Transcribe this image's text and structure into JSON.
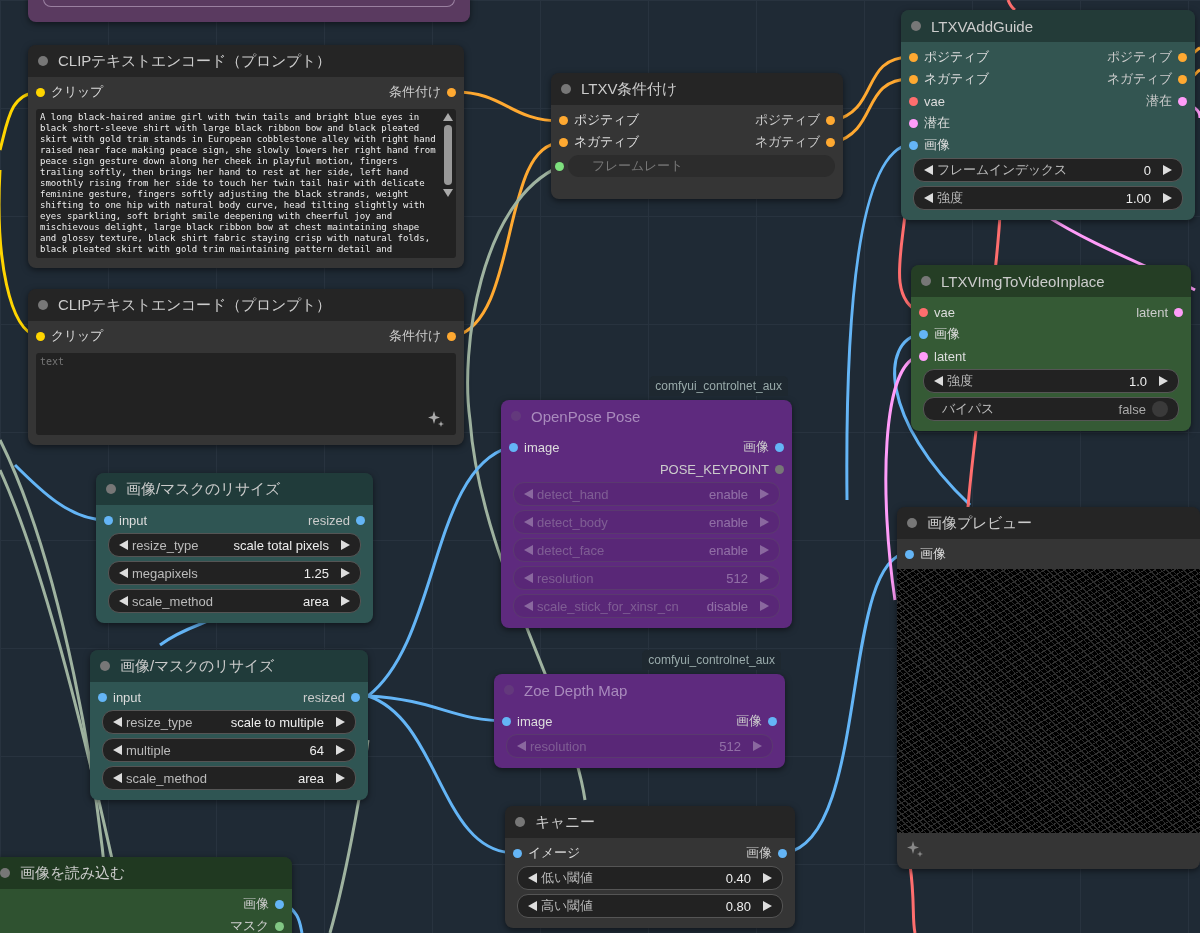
{
  "nodes": [
    {
      "title": "CLIPテキストエンコード（プロンプト）",
      "color": "#353535",
      "bypassed": false,
      "inputs": [
        {
          "label": "クリップ",
          "color": "#ffd500"
        }
      ],
      "outputs": [
        {
          "label": "条件付け",
          "color": "#ffa931"
        }
      ],
      "prompt": {
        "value": "A long black-haired anime girl with twin tails and bright blue eyes in black short-sleeve shirt with large black ribbon bow and black pleated skirt with gold trim stands in European cobblestone alley with right hand raised near face making peace sign, she slowly lowers her right hand from peace sign gesture down along her cheek in playful motion, fingers trailing softly, then brings her hand to rest at her side, left hand smoothly rising from her side to touch her twin tail hair with delicate feminine gesture, fingers softly adjusting the black strands, weight shifting to one hip with natural body curve, head tilting slightly with eyes sparkling, soft bright smile deepening with cheerful joy and mischievous delight, large black ribbon bow at chest maintaining shape and glossy texture, black shirt fabric staying crisp with natural folds, black pleated skirt with gold trim maintaining pattern detail and"
      }
    },
    {
      "title": "CLIPテキストエンコード（プロンプト）",
      "color": "#353535",
      "bypassed": false,
      "inputs": [
        {
          "label": "クリップ",
          "color": "#ffd500"
        }
      ],
      "outputs": [
        {
          "label": "条件付け",
          "color": "#ffa931"
        }
      ],
      "prompt": {
        "placeholder": "text"
      }
    },
    {
      "title": "LTXV条件付け",
      "color": "#353535",
      "bypassed": false,
      "inputs": [
        {
          "label": "ポジティブ",
          "color": "#ffa931"
        },
        {
          "label": "ネガティブ",
          "color": "#ffa931"
        }
      ],
      "outputs": [
        {
          "label": "ポジティブ",
          "color": "#ffa931"
        },
        {
          "label": "ネガティブ",
          "color": "#ffa931"
        }
      ],
      "widgets": [
        {
          "kind": "socket",
          "label": "フレームレート",
          "color": "#7ee07e"
        }
      ]
    },
    {
      "title": "LTXVAddGuide",
      "color": "#335551",
      "bypassed": false,
      "inputs": [
        {
          "label": "ポジティブ",
          "color": "#ffa931"
        },
        {
          "label": "ネガティブ",
          "color": "#ffa931"
        },
        {
          "label": "vae",
          "color": "#ff6e6e"
        },
        {
          "label": "潜在",
          "color": "#ff9cf9"
        },
        {
          "label": "画像",
          "color": "#64b5f6"
        }
      ],
      "outputs": [
        {
          "label": "ポジティブ",
          "color": "#ffa931"
        },
        {
          "label": "ネガティブ",
          "color": "#ffa931"
        },
        {
          "label": "潜在",
          "color": "#ff9cf9"
        }
      ],
      "widgets": [
        {
          "kind": "number",
          "label": "フレームインデックス",
          "value": "0"
        },
        {
          "kind": "number",
          "label": "強度",
          "value": "1.00"
        }
      ]
    },
    {
      "title": "LTXVImgToVideoInplace",
      "color": "#355a35",
      "bypassed": false,
      "inputs": [
        {
          "label": "vae",
          "color": "#ff6e6e"
        },
        {
          "label": "画像",
          "color": "#64b5f6"
        },
        {
          "label": "latent",
          "color": "#ff9cf9"
        }
      ],
      "outputs": [
        {
          "label": "latent",
          "color": "#ff9cf9"
        }
      ],
      "widgets": [
        {
          "kind": "number",
          "label": "強度",
          "value": "1.0"
        },
        {
          "kind": "toggle",
          "label": "バイパス",
          "value": "false",
          "on": false
        }
      ]
    },
    {
      "title": "画像/マスクのリサイズ",
      "color": "#2f5553",
      "bypassed": false,
      "inputs": [
        {
          "label": "input",
          "color": "#64b5f6"
        }
      ],
      "outputs": [
        {
          "label": "resized",
          "color": "#64b5f6"
        }
      ],
      "widgets": [
        {
          "kind": "combo",
          "label": "resize_type",
          "value": "scale total pixels"
        },
        {
          "kind": "number",
          "label": "megapixels",
          "value": "1.25"
        },
        {
          "kind": "combo",
          "label": "scale_method",
          "value": "area"
        }
      ]
    },
    {
      "title": "OpenPose Pose",
      "color": "#5e2a7e",
      "bypassed": true,
      "badge": "comfyui_controlnet_aux",
      "inputs": [
        {
          "label": "image",
          "color": "#64b5f6"
        }
      ],
      "outputs": [
        {
          "label": "画像",
          "color": "#64b5f6"
        },
        {
          "label": "POSE_KEYPOINT",
          "color": "#777777"
        }
      ],
      "widgets": [
        {
          "kind": "combo",
          "label": "detect_hand",
          "value": "enable"
        },
        {
          "kind": "combo",
          "label": "detect_body",
          "value": "enable"
        },
        {
          "kind": "combo",
          "label": "detect_face",
          "value": "enable"
        },
        {
          "kind": "number",
          "label": "resolution",
          "value": "512"
        },
        {
          "kind": "combo",
          "label": "scale_stick_for_xinsr_cn",
          "value": "disable"
        }
      ]
    },
    {
      "title": "画像/マスクのリサイズ",
      "color": "#2f5553",
      "bypassed": false,
      "inputs": [
        {
          "label": "input",
          "color": "#64b5f6"
        }
      ],
      "outputs": [
        {
          "label": "resized",
          "color": "#64b5f6"
        }
      ],
      "widgets": [
        {
          "kind": "combo",
          "label": "resize_type",
          "value": "scale to multiple"
        },
        {
          "kind": "number",
          "label": "multiple",
          "value": "64"
        },
        {
          "kind": "combo",
          "label": "scale_method",
          "value": "area"
        }
      ]
    },
    {
      "title": "Zoe Depth Map",
      "color": "#5e2a7e",
      "bypassed": true,
      "badge": "comfyui_controlnet_aux",
      "inputs": [
        {
          "label": "image",
          "color": "#64b5f6"
        }
      ],
      "outputs": [
        {
          "label": "画像",
          "color": "#64b5f6"
        }
      ],
      "widgets": [
        {
          "kind": "number",
          "label": "resolution",
          "value": "512"
        }
      ]
    },
    {
      "title": "画像プレビュー",
      "color": "#353535",
      "bypassed": false,
      "inputs": [
        {
          "label": "画像",
          "color": "#64b5f6"
        }
      ],
      "preview": true
    },
    {
      "title": "キャニー",
      "color": "#353535",
      "bypassed": false,
      "inputs": [
        {
          "label": "イメージ",
          "color": "#64b5f6"
        }
      ],
      "outputs": [
        {
          "label": "画像",
          "color": "#64b5f6"
        }
      ],
      "widgets": [
        {
          "kind": "number",
          "label": "低い閾値",
          "value": "0.40"
        },
        {
          "kind": "number",
          "label": "高い閾値",
          "value": "0.80"
        }
      ]
    },
    {
      "title": "画像を読み込む",
      "color": "#2f5230",
      "bypassed": false,
      "outputs": [
        {
          "label": "画像",
          "color": "#64b5f6"
        },
        {
          "label": "マスク",
          "color": "#81c784"
        }
      ]
    }
  ]
}
